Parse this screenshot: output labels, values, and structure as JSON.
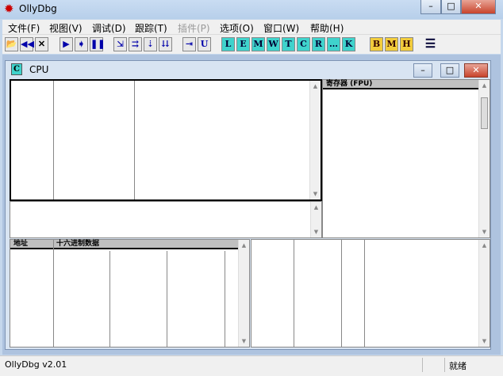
{
  "app": {
    "title": "OllyDbg",
    "icon": "bug-icon"
  },
  "window_controls": {
    "minimize": "–",
    "maximize": "□",
    "close": "✕"
  },
  "menu": [
    "文件(F)",
    "视图(V)",
    "调试(D)",
    "跟踪(T)",
    "插件(P)",
    "选项(O)",
    "窗口(W)",
    "帮助(H)"
  ],
  "toolbar": {
    "file": [
      {
        "icon": "open-icon",
        "label": "📂"
      },
      {
        "icon": "restart-icon",
        "label": "◀◀"
      },
      {
        "icon": "close-icon",
        "label": "✕"
      }
    ],
    "run": [
      {
        "icon": "run-icon",
        "label": "▶"
      },
      {
        "icon": "step-icon",
        "label": "➧"
      },
      {
        "icon": "pause-icon",
        "label": "❚❚"
      }
    ],
    "step": [
      {
        "icon": "step-into-icon",
        "label": "⇲"
      },
      {
        "icon": "step-over-icon",
        "label": "⇉"
      },
      {
        "icon": "trace-into-icon",
        "label": "⇣"
      },
      {
        "icon": "trace-over-icon",
        "label": "⇊"
      }
    ],
    "misc": [
      {
        "icon": "execute-till-return-icon",
        "label": "⇥"
      },
      {
        "icon": "execute-till-user-icon",
        "label": "U"
      }
    ],
    "windows": [
      "L",
      "E",
      "M",
      "W",
      "T",
      "C",
      "R",
      "…",
      "K"
    ],
    "breakpoints": [
      "B",
      "M",
      "H"
    ],
    "list_icon": "☰"
  },
  "cpu_window": {
    "title": "CPU",
    "icon_letter": "C"
  },
  "registers_header": "寄存器 (FPU)",
  "dump_headers": [
    "地址",
    "十六进制数据"
  ],
  "scroll": {
    "up": "▲",
    "down": "▼"
  },
  "status": {
    "version": "OllyDbg v2.01",
    "state": "就绪"
  }
}
